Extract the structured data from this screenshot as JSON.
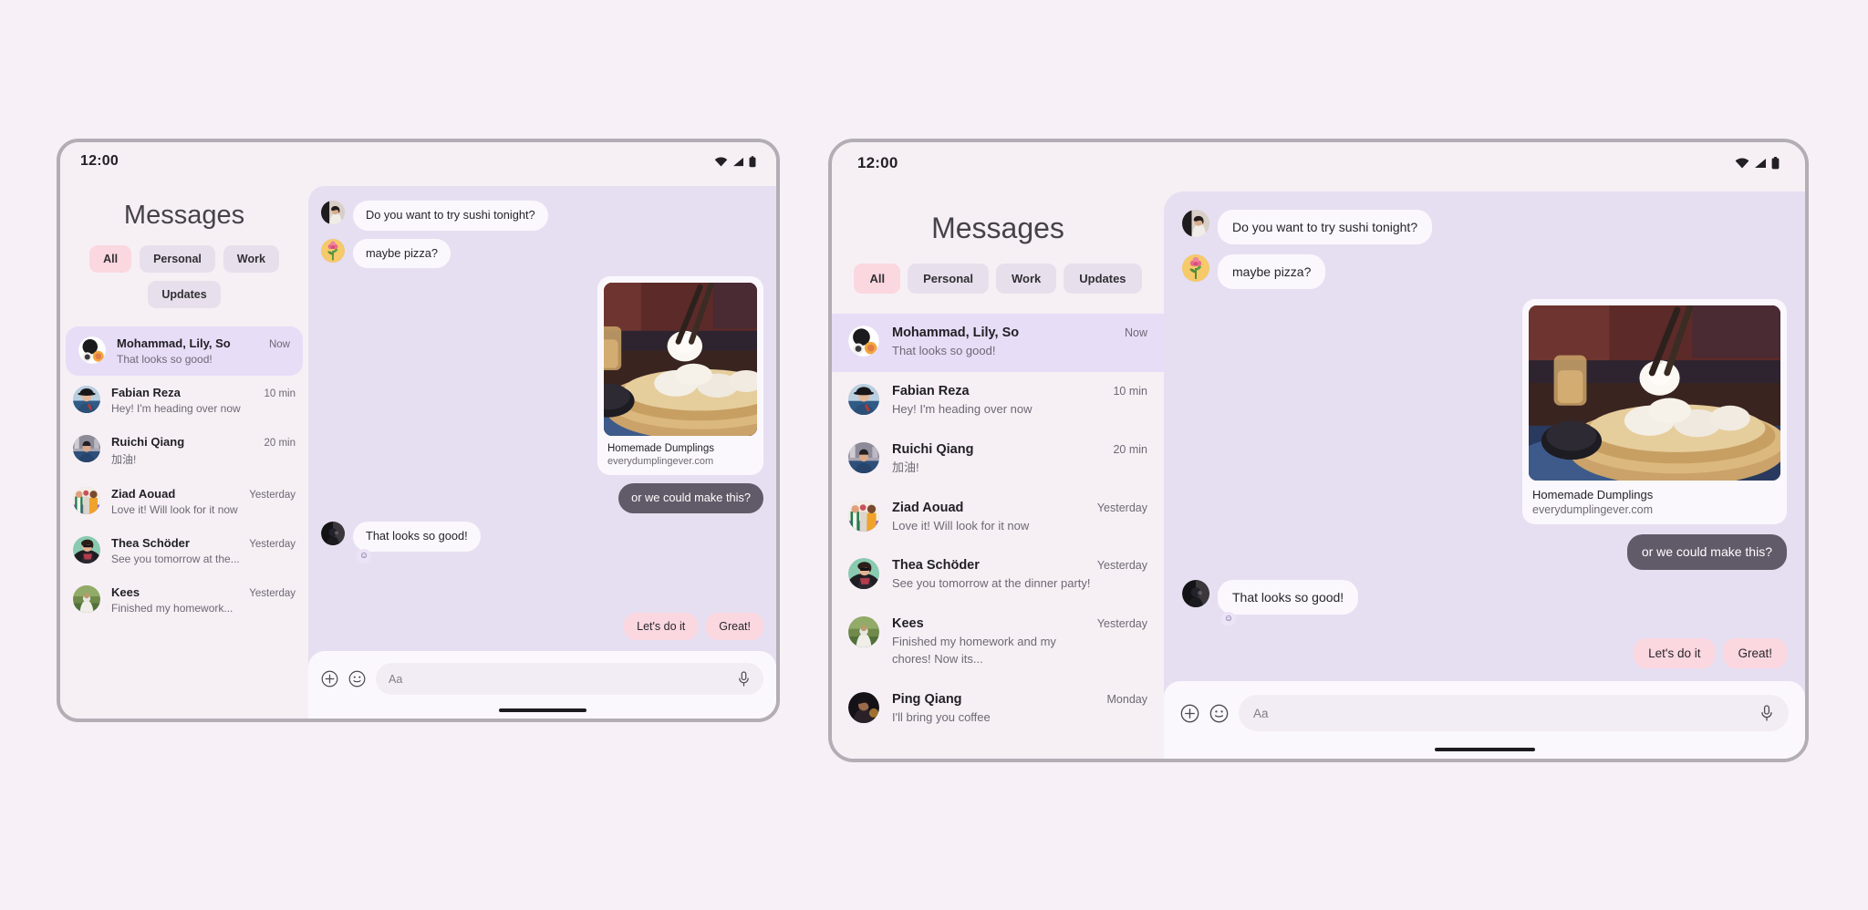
{
  "background_color": "#f7f0f6",
  "theme": {
    "chat_background": "#e6dff1",
    "list_background": "#f6f0f5",
    "selected_item": "#e8ddf7",
    "accent_pink": "#fbd7e0",
    "outgoing_bubble": "#615a68",
    "incoming_bubble": "#fbf8fd"
  },
  "devices": [
    {
      "id": "left",
      "status": {
        "time": "12:00",
        "icons": [
          "wifi-icon",
          "signal-icon",
          "battery-icon"
        ]
      },
      "list": {
        "title": "Messages",
        "filters": [
          {
            "label": "All",
            "active": true
          },
          {
            "label": "Personal",
            "active": false
          },
          {
            "label": "Work",
            "active": false
          },
          {
            "label": "Updates",
            "active": false
          }
        ],
        "conversations": [
          {
            "name": "Mohammad, Lily, So",
            "preview": "That looks so good!",
            "time": "Now",
            "selected": true,
            "avatar": "group-avatar"
          },
          {
            "name": "Fabian Reza",
            "preview": "Hey! I'm heading over now",
            "time": "10 min",
            "selected": false,
            "avatar": "person-hat-avatar"
          },
          {
            "name": "Ruichi Qiang",
            "preview": "加油!",
            "time": "20 min",
            "selected": false,
            "avatar": "person-street-avatar"
          },
          {
            "name": "Ziad Aouad",
            "preview": "Love it! Will look for it now",
            "time": "Yesterday",
            "selected": false,
            "avatar": "people-colorful-avatar"
          },
          {
            "name": "Thea Schöder",
            "preview": "See you tomorrow at the...",
            "time": "Yesterday",
            "selected": false,
            "avatar": "person-sunglasses-avatar"
          },
          {
            "name": "Kees",
            "preview": "Finished my homework...",
            "time": "Yesterday",
            "selected": false,
            "avatar": "person-field-avatar"
          }
        ]
      },
      "chat": {
        "messages": [
          {
            "kind": "incoming",
            "text": "Do you want to try sushi tonight?",
            "avatar": "person-portrait-avatar"
          },
          {
            "kind": "incoming",
            "text": "maybe pizza?",
            "avatar": "flower-avatar"
          },
          {
            "kind": "card",
            "title": "Homemade Dumplings",
            "url": "everydumplingever.com",
            "image": "dumplings-photo"
          },
          {
            "kind": "outgoing",
            "text": "or we could make this?"
          },
          {
            "kind": "incoming",
            "text": "That looks so good!",
            "avatar": "person-dark-avatar",
            "reaction": "☺"
          }
        ],
        "quick_replies": [
          "Let's do it",
          "Great!"
        ],
        "composer": {
          "add_icon": "plus-circle-icon",
          "emoji_icon": "emoji-icon",
          "placeholder": "Aa",
          "value": "",
          "mic_icon": "microphone-icon"
        }
      }
    },
    {
      "id": "right",
      "status": {
        "time": "12:00",
        "icons": [
          "wifi-icon",
          "signal-icon",
          "battery-icon"
        ]
      },
      "list": {
        "title": "Messages",
        "filters": [
          {
            "label": "All",
            "active": true
          },
          {
            "label": "Personal",
            "active": false
          },
          {
            "label": "Work",
            "active": false
          },
          {
            "label": "Updates",
            "active": false
          }
        ],
        "conversations": [
          {
            "name": "Mohammad, Lily, So",
            "preview": "That looks so good!",
            "time": "Now",
            "selected": true,
            "avatar": "group-avatar"
          },
          {
            "name": "Fabian Reza",
            "preview": "Hey! I'm heading over now",
            "time": "10 min",
            "selected": false,
            "avatar": "person-hat-avatar"
          },
          {
            "name": "Ruichi Qiang",
            "preview": "加油!",
            "time": "20 min",
            "selected": false,
            "avatar": "person-street-avatar"
          },
          {
            "name": "Ziad Aouad",
            "preview": "Love it! Will look for it now",
            "time": "Yesterday",
            "selected": false,
            "avatar": "people-colorful-avatar"
          },
          {
            "name": "Thea Schöder",
            "preview": "See you tomorrow at the dinner party!",
            "time": "Yesterday",
            "selected": false,
            "avatar": "person-sunglasses-avatar"
          },
          {
            "name": "Kees",
            "preview": "Finished my homework and my\nchores! Now its...",
            "time": "Yesterday",
            "selected": false,
            "avatar": "person-field-avatar"
          },
          {
            "name": "Ping Qiang",
            "preview": "I'll bring you coffee",
            "time": "Monday",
            "selected": false,
            "avatar": "person-night-avatar"
          }
        ]
      },
      "chat": {
        "messages": [
          {
            "kind": "incoming",
            "text": "Do you want to try sushi tonight?",
            "avatar": "person-portrait-avatar"
          },
          {
            "kind": "incoming",
            "text": "maybe pizza?",
            "avatar": "flower-avatar"
          },
          {
            "kind": "card",
            "title": "Homemade Dumplings",
            "url": "everydumplingever.com",
            "image": "dumplings-photo"
          },
          {
            "kind": "outgoing",
            "text": "or we could make this?"
          },
          {
            "kind": "incoming",
            "text": "That looks so good!",
            "avatar": "person-dark-avatar",
            "reaction": "☺"
          }
        ],
        "quick_replies": [
          "Let's do it",
          "Great!"
        ],
        "composer": {
          "add_icon": "plus-circle-icon",
          "emoji_icon": "emoji-icon",
          "placeholder": "Aa",
          "value": "",
          "mic_icon": "microphone-icon"
        }
      }
    }
  ]
}
